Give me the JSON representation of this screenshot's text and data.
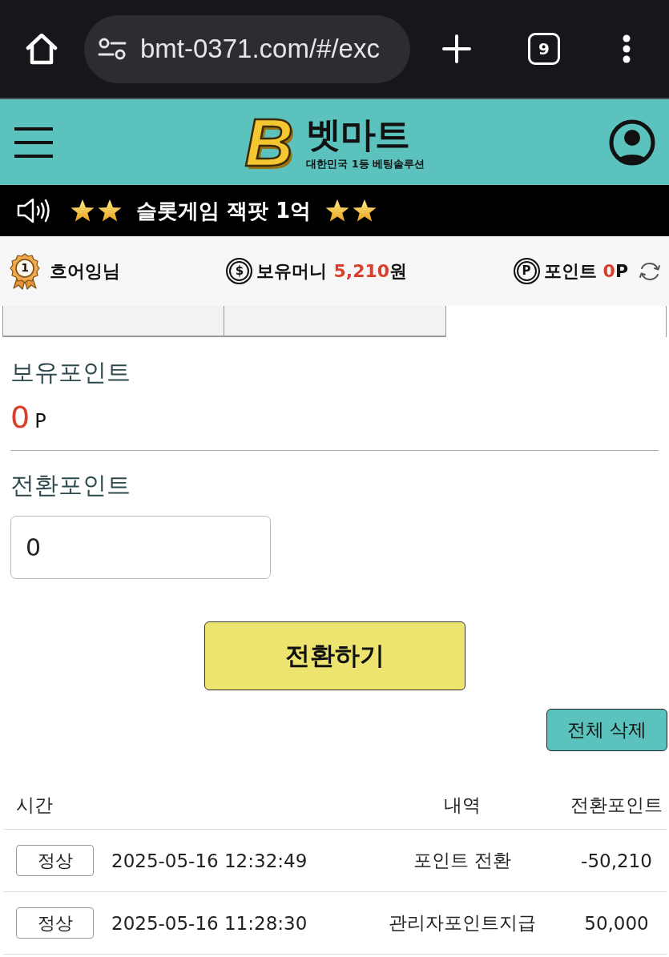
{
  "browser": {
    "url": "bmt-0371.com/#/exc",
    "tab_count": "9"
  },
  "header": {
    "logo_mark": "B",
    "logo_title": "벳마트",
    "logo_subtitle": "대한민국 1등 베팅솔루션"
  },
  "notice": {
    "text": "슬롯게임 잭팟 1억"
  },
  "user_bar": {
    "rank": "1",
    "username": "흐어잉님",
    "money": {
      "icon": "$",
      "label": "보유머니",
      "value": "5,210",
      "unit": "원"
    },
    "points": {
      "icon": "P",
      "label": "포인트",
      "value": "0",
      "unit": "P"
    }
  },
  "tabs": [
    {
      "selected": false
    },
    {
      "selected": false
    },
    {
      "selected": true
    }
  ],
  "balance": {
    "label": "보유포인트",
    "value": "0",
    "unit": "P"
  },
  "conversion": {
    "label": "전환포인트",
    "value": "0",
    "button": "전환하기"
  },
  "history": {
    "delete_all_button": "전체 삭제",
    "columns": [
      "시간",
      "내역",
      "전환포인트"
    ],
    "rows": [
      {
        "status": "정상",
        "time": "2025-05-16 12:32:49",
        "description": "포인트 전환",
        "points": "-50,210"
      },
      {
        "status": "정상",
        "time": "2025-05-16 11:28:30",
        "description": "관리자포인트지급",
        "points": "50,000"
      }
    ]
  }
}
